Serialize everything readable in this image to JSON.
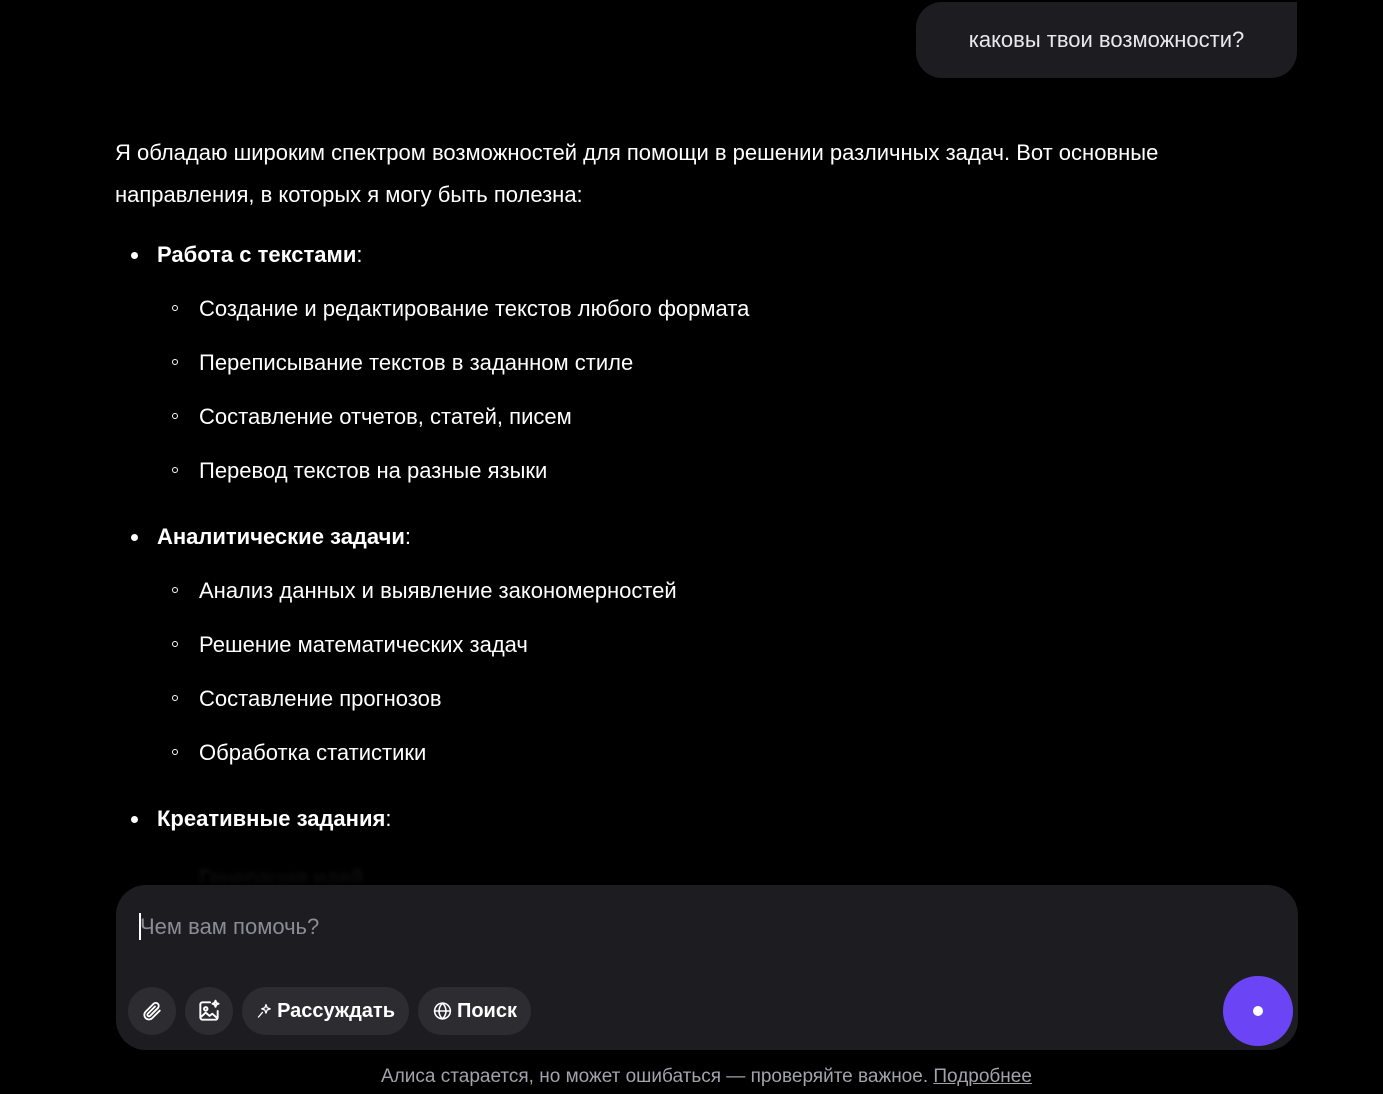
{
  "user_message": "каковы твои возможности?",
  "answer": {
    "intro": "Я обладаю широким спектром возможностей для помощи в решении различных задач. Вот основные направления, в которых я могу быть полезна:",
    "sections": [
      {
        "title": "Работа с текстами",
        "items": [
          "Создание и редактирование текстов любого формата",
          "Переписывание текстов в заданном стиле",
          "Составление отчетов, статей, писем",
          "Перевод текстов на разные языки"
        ]
      },
      {
        "title": "Аналитические задачи",
        "items": [
          "Анализ данных и выявление закономерностей",
          "Решение математических задач",
          "Составление прогнозов",
          "Обработка статистики"
        ]
      },
      {
        "title": "Креативные задания",
        "items": [
          "Генерация идей"
        ]
      }
    ]
  },
  "composer": {
    "placeholder": "Чем вам помочь?",
    "attach_icon": "paperclip-icon",
    "image_icon": "image-sparkle-icon",
    "reason_icon": "sparkle-icon",
    "reason_label": "Рассуждать",
    "search_icon": "globe-icon",
    "search_label": "Поиск",
    "send_color": "#6b45f5"
  },
  "disclaimer": {
    "text": "Алиса старается, но может ошибаться — проверяйте важное.",
    "link": "Подробнее"
  }
}
